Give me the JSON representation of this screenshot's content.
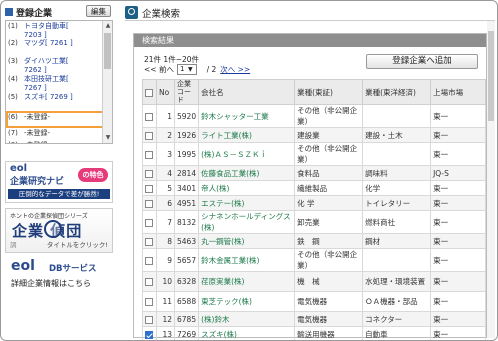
{
  "sidebar": {
    "title": "登録企業",
    "edit_label": "編集",
    "items": [
      {
        "idx": "(1)",
        "lines": [
          "トヨタ自動車[",
          "7203 ]"
        ],
        "plain": false
      },
      {
        "idx": "(2)",
        "lines": [
          "マツダ[ 7261 ]"
        ],
        "plain": false
      },
      {
        "idx": "(3)",
        "lines": [
          "ダイハツ工業[",
          "7262 ]"
        ],
        "plain": false
      },
      {
        "idx": "(4)",
        "lines": [
          "本田技研工業[",
          "7267 ]"
        ],
        "plain": false
      },
      {
        "idx": "(5)",
        "lines": [
          "スズキ[ 7269 ]"
        ],
        "plain": false
      },
      {
        "idx": "(6)",
        "lines": [
          "-未登録-"
        ],
        "plain": true
      },
      {
        "idx": "(7)",
        "lines": [
          "-未登録-"
        ],
        "plain": true
      },
      {
        "idx": "(8)",
        "lines": [
          "-未登録-"
        ],
        "plain": true
      }
    ]
  },
  "banners": {
    "b1_eol": "eol",
    "b1_nav": "企業研究ナビ",
    "b1_badge": "の特色",
    "b1_sub": "圧倒的なデータで差が勝然!",
    "b2_top": "ホントの企業探偵団シリーズ",
    "b2_big": "企業 偵団",
    "b2_group": "調",
    "b2_click": "タイトルをクリック!",
    "b3_eol": "eol",
    "b3_db": "DBサービス",
    "b3_desc": "詳細企業情報はこちら"
  },
  "main": {
    "title": "企業検索",
    "panel_title": "検索結果",
    "count": "21件 1件~20件",
    "prev": "<< 前へ",
    "page_value": "1",
    "page_total": "/  2",
    "next": "次へ >>",
    "add_button": "登録企業へ追加"
  },
  "table": {
    "headers": [
      "",
      "No",
      "企業コード",
      "会社名",
      "業種(東証)",
      "業種(東洋経済)",
      "上場市場"
    ],
    "rows": [
      {
        "no": "1",
        "code": "5920",
        "name": "鈴木シャッター工業",
        "ind_tse": "その他（非公開企業）",
        "ind_toyo": "",
        "market": "東一",
        "checked": false
      },
      {
        "no": "2",
        "code": "1926",
        "name": "ライト工業(株)",
        "ind_tse": "建設業",
        "ind_toyo": "建設・土木",
        "market": "東一",
        "checked": false
      },
      {
        "no": "3",
        "code": "1995",
        "name": "(株)ＡＳ－ＳＺＫｉ",
        "ind_tse": "その他（非公開企業）",
        "ind_toyo": "",
        "market": "東一",
        "checked": false
      },
      {
        "no": "4",
        "code": "2814",
        "name": "佐藤食品工業(株)",
        "ind_tse": "食料品",
        "ind_toyo": "調味料",
        "market": "JQ-S",
        "checked": false
      },
      {
        "no": "5",
        "code": "3401",
        "name": "帝人(株)",
        "ind_tse": "繊維製品",
        "ind_toyo": "化学",
        "market": "東一",
        "checked": false
      },
      {
        "no": "6",
        "code": "4951",
        "name": "エステー(株)",
        "ind_tse": "化 学",
        "ind_toyo": "トイレタリー",
        "market": "東一",
        "checked": false
      },
      {
        "no": "7",
        "code": "8132",
        "name": "シナネンホールディングス(株)",
        "ind_tse": "卸売業",
        "ind_toyo": "燃料商社",
        "market": "東一",
        "checked": false
      },
      {
        "no": "8",
        "code": "5463",
        "name": "丸一鋼管(株)",
        "ind_tse": "鉄　鋼",
        "ind_toyo": "鋼材",
        "market": "東一",
        "checked": false
      },
      {
        "no": "9",
        "code": "5657",
        "name": "鈴木金属工業(株)",
        "ind_tse": "その他（非公開企業）",
        "ind_toyo": "",
        "market": "東一",
        "checked": false
      },
      {
        "no": "10",
        "code": "6328",
        "name": "荏原実業(株)",
        "ind_tse": "機　械",
        "ind_toyo": "水処理・環境装置",
        "market": "東一",
        "checked": false
      },
      {
        "no": "11",
        "code": "6588",
        "name": "東芝テック(株)",
        "ind_tse": "電気機器",
        "ind_toyo": "ＯＡ機器・部品",
        "market": "東一",
        "checked": false
      },
      {
        "no": "12",
        "code": "6785",
        "name": "(株)鈴木",
        "ind_tse": "電気機器",
        "ind_toyo": "コネクター",
        "market": "東一",
        "checked": false
      },
      {
        "no": "13",
        "code": "7269",
        "name": "スズキ(株)",
        "ind_tse": "輸送用機器",
        "ind_toyo": "自動車",
        "market": "東一",
        "checked": true
      }
    ]
  },
  "colors": {
    "accent": "#2b62a8",
    "highlight": "#f5a03a",
    "link_green": "#1c7a4a",
    "panel_header": "#8e8e8e",
    "check_blue": "#2f6fd1"
  }
}
